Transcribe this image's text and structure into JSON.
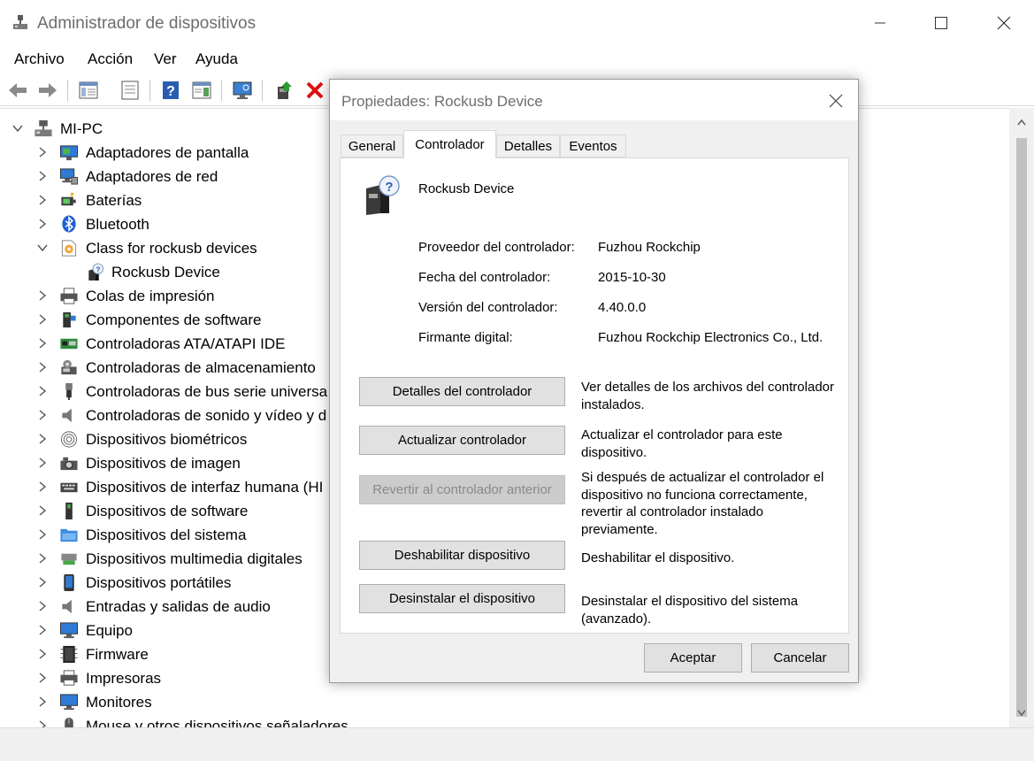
{
  "window": {
    "title": "Administrador de dispositivos"
  },
  "menu": [
    "Archivo",
    "Acción",
    "Ver",
    "Ayuda"
  ],
  "toolbar": {
    "icons": [
      "back-arrow-icon",
      "forward-arrow-icon",
      "show-hide-console-tree-icon",
      "properties-icon",
      "help-icon",
      "action-pane-icon",
      "scan-hardware-icon",
      "update-driver-icon",
      "uninstall-x-icon"
    ]
  },
  "tree": {
    "root": "MI-PC",
    "categories": [
      {
        "label": "Adaptadores de pantalla",
        "icon": "display-adapter-icon"
      },
      {
        "label": "Adaptadores de red",
        "icon": "network-adapter-icon"
      },
      {
        "label": "Baterías",
        "icon": "battery-icon"
      },
      {
        "label": "Bluetooth",
        "icon": "bluetooth-icon"
      },
      {
        "label": "Class for rockusb devices",
        "icon": "rockusb-class-icon",
        "expanded": true,
        "children": [
          "Rockusb Device"
        ]
      },
      {
        "label": "Colas de impresión",
        "icon": "print-queue-icon"
      },
      {
        "label": "Componentes de software",
        "icon": "software-component-icon"
      },
      {
        "label": "Controladoras ATA/ATAPI IDE",
        "icon": "ide-controller-icon"
      },
      {
        "label": "Controladoras de almacenamiento",
        "icon": "storage-controller-icon"
      },
      {
        "label": "Controladoras de bus serie universa",
        "icon": "usb-icon"
      },
      {
        "label": "Controladoras de sonido y vídeo y d",
        "icon": "sound-icon"
      },
      {
        "label": "Dispositivos biométricos",
        "icon": "fingerprint-icon"
      },
      {
        "label": "Dispositivos de imagen",
        "icon": "camera-icon"
      },
      {
        "label": "Dispositivos de interfaz humana (HI",
        "icon": "keyboard-icon"
      },
      {
        "label": "Dispositivos de software",
        "icon": "software-device-icon"
      },
      {
        "label": "Dispositivos del sistema",
        "icon": "system-folder-icon"
      },
      {
        "label": "Dispositivos multimedia digitales",
        "icon": "multimedia-icon"
      },
      {
        "label": "Dispositivos portátiles",
        "icon": "portable-device-icon"
      },
      {
        "label": "Entradas y salidas de audio",
        "icon": "speaker-icon"
      },
      {
        "label": "Equipo",
        "icon": "computer-icon"
      },
      {
        "label": "Firmware",
        "icon": "firmware-icon"
      },
      {
        "label": "Impresoras",
        "icon": "printer-icon"
      },
      {
        "label": "Monitores",
        "icon": "monitor-icon"
      },
      {
        "label": "Mouse y otros dispositivos señaladores",
        "icon": "mouse-icon"
      }
    ]
  },
  "dialog": {
    "title": "Propiedades: Rockusb Device",
    "tabs": [
      "General",
      "Controlador",
      "Detalles",
      "Eventos"
    ],
    "active_tab": "Controlador",
    "device_name": "Rockusb Device",
    "properties": [
      {
        "label": "Proveedor del controlador:",
        "value": "Fuzhou Rockchip"
      },
      {
        "label": "Fecha del controlador:",
        "value": "2015-10-30"
      },
      {
        "label": "Versión del controlador:",
        "value": "4.40.0.0"
      },
      {
        "label": "Firmante digital:",
        "value": "Fuzhou Rockchip Electronics Co., Ltd."
      }
    ],
    "actions": [
      {
        "label": "Detalles del controlador",
        "description": "Ver detalles de los archivos del controlador instalados.",
        "enabled": true
      },
      {
        "label": "Actualizar controlador",
        "description": "Actualizar el controlador para este dispositivo.",
        "enabled": true
      },
      {
        "label": "Revertir al controlador anterior",
        "description": "Si después de actualizar el controlador el dispositivo no funciona correctamente, revertir al controlador instalado previamente.",
        "enabled": false
      },
      {
        "label": "Deshabilitar dispositivo",
        "description": "Deshabilitar el dispositivo.",
        "enabled": true
      },
      {
        "label": "Desinstalar el dispositivo",
        "description": "Desinstalar el dispositivo del sistema (avanzado).",
        "enabled": true
      }
    ],
    "ok_label": "Aceptar",
    "cancel_label": "Cancelar"
  }
}
